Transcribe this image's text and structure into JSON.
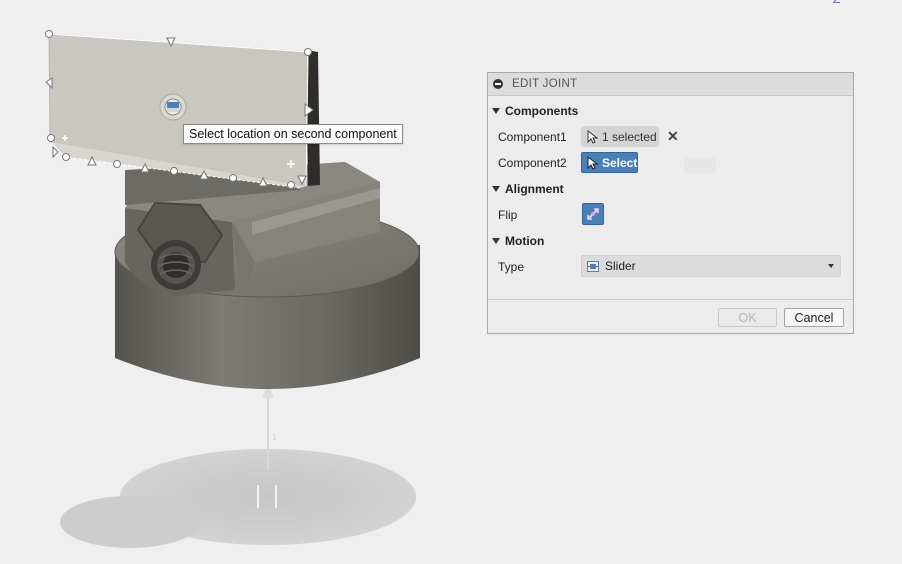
{
  "viewport": {
    "tooltip": "Select location on second component",
    "viewcube_label": "Z"
  },
  "dialog": {
    "title": "EDIT JOINT",
    "sections": {
      "components": "Components",
      "alignment": "Alignment",
      "motion": "Motion"
    },
    "component1": {
      "label": "Component1",
      "value": "1 selected"
    },
    "component2": {
      "label": "Component2",
      "button": "Select"
    },
    "flip": {
      "label": "Flip"
    },
    "type": {
      "label": "Type",
      "selected": "Slider"
    },
    "ok_label": "OK",
    "cancel_label": "Cancel"
  },
  "colors": {
    "accent": "#4a7fb8",
    "background": "#efefef",
    "model": "#7a7870"
  }
}
